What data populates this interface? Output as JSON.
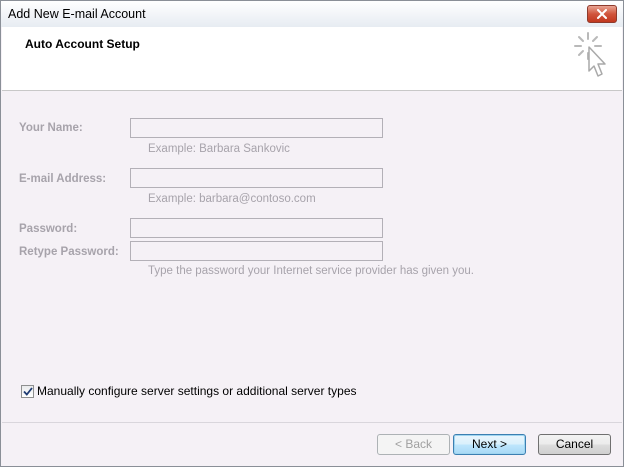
{
  "window": {
    "title": "Add New E-mail Account"
  },
  "header": {
    "title": "Auto Account Setup",
    "icon": "wizard-cursor-icon"
  },
  "form": {
    "your_name": {
      "label": "Your Name:",
      "value": "",
      "hint": "Example: Barbara Sankovic"
    },
    "email": {
      "label": "E-mail Address:",
      "value": "",
      "hint": "Example: barbara@contoso.com"
    },
    "password": {
      "label": "Password:",
      "value": ""
    },
    "retype_password": {
      "label": "Retype Password:",
      "value": "",
      "hint": "Type the password your Internet service provider has given you."
    }
  },
  "manual_config": {
    "label": "Manually configure server settings or additional server types",
    "checked": true
  },
  "buttons": {
    "back": "< Back",
    "next": "Next >",
    "cancel": "Cancel"
  },
  "colors": {
    "close_button": "#c9442a",
    "default_button_border": "#3c7fb1",
    "disabled_text": "#a7a3ab"
  }
}
